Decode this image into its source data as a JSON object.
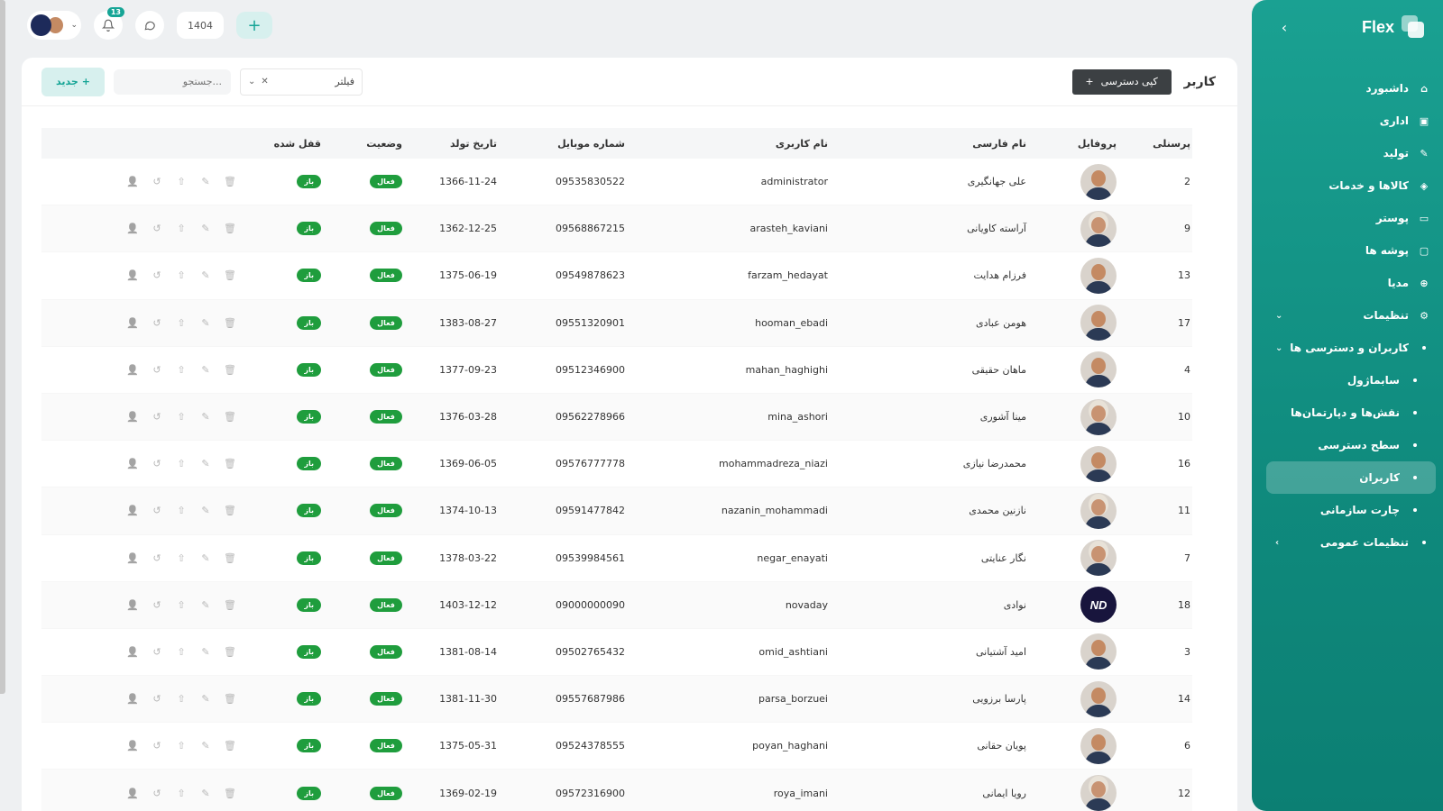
{
  "topbar": {
    "notification_count": "13",
    "year": "1404"
  },
  "sidebar": {
    "brand": "Flex",
    "items": [
      {
        "label": "داشبورد",
        "icon": "home-icon",
        "type": "main"
      },
      {
        "label": "اداری",
        "icon": "briefcase-icon",
        "type": "main"
      },
      {
        "label": "تولید",
        "icon": "production-icon",
        "type": "main"
      },
      {
        "label": "کالاها و خدمات",
        "icon": "box-icon",
        "type": "main"
      },
      {
        "label": "پوستر",
        "icon": "poster-icon",
        "type": "main"
      },
      {
        "label": "پوشه ها",
        "icon": "folder-icon",
        "type": "main"
      },
      {
        "label": "مدیا",
        "icon": "media-icon",
        "type": "main"
      },
      {
        "label": "تنظیمات",
        "icon": "gear-icon",
        "type": "main",
        "expanded": true
      },
      {
        "label": "کاربران و دسترسی ها",
        "type": "sub",
        "expanded": true
      },
      {
        "label": "سابماژول",
        "type": "subsub"
      },
      {
        "label": "نقش‌ها و دپارتمان‌ها",
        "type": "subsub"
      },
      {
        "label": "سطح دسترسی",
        "type": "subsub"
      },
      {
        "label": "کاربران",
        "type": "subsub",
        "active": true
      },
      {
        "label": "چارت سازمانی",
        "type": "subsub"
      },
      {
        "label": "تنظیمات عمومی",
        "type": "sub",
        "expanded": false
      }
    ]
  },
  "toolbar": {
    "title": "کاربر",
    "copy_button": "کپی دسترسی",
    "filter_label": "فیلتر",
    "search_placeholder": "جستجو...",
    "new_button": "جدید"
  },
  "table": {
    "headers": {
      "id": "پرسنلی",
      "profile": "پروفایل",
      "name": "نام فارسی",
      "username": "نام کاربری",
      "mobile": "شماره موبایل",
      "birth": "تاریخ تولد",
      "status": "وضعیت",
      "locked": "قفل شده"
    },
    "rows": [
      {
        "id": "2",
        "name": "علی جهانگیری",
        "username": "administrator",
        "mobile": "09535830522",
        "birth": "1366-11-24",
        "status": "فعال",
        "locked": "باز",
        "avatar": "male"
      },
      {
        "id": "9",
        "name": "آراسته کاویانی",
        "username": "arasteh_kaviani",
        "mobile": "09568867215",
        "birth": "1362-12-25",
        "status": "فعال",
        "locked": "باز",
        "avatar": "female"
      },
      {
        "id": "13",
        "name": "فرزام هدایت",
        "username": "farzam_hedayat",
        "mobile": "09549878623",
        "birth": "1375-06-19",
        "status": "فعال",
        "locked": "باز",
        "avatar": "male"
      },
      {
        "id": "17",
        "name": "هومن عبادی",
        "username": "hooman_ebadi",
        "mobile": "09551320901",
        "birth": "1383-08-27",
        "status": "فعال",
        "locked": "باز",
        "avatar": "male"
      },
      {
        "id": "4",
        "name": "ماهان حقیقی",
        "username": "mahan_haghighi",
        "mobile": "09512346900",
        "birth": "1377-09-23",
        "status": "فعال",
        "locked": "باز",
        "avatar": "male"
      },
      {
        "id": "10",
        "name": "مینا آشوری",
        "username": "mina_ashori",
        "mobile": "09562278966",
        "birth": "1376-03-28",
        "status": "فعال",
        "locked": "باز",
        "avatar": "female"
      },
      {
        "id": "16",
        "name": "محمدرضا نیازی",
        "username": "mohammadreza_niazi",
        "mobile": "09576777778",
        "birth": "1369-06-05",
        "status": "فعال",
        "locked": "باز",
        "avatar": "male"
      },
      {
        "id": "11",
        "name": "نازنین محمدی",
        "username": "nazanin_mohammadi",
        "mobile": "09591477842",
        "birth": "1374-10-13",
        "status": "فعال",
        "locked": "باز",
        "avatar": "female"
      },
      {
        "id": "7",
        "name": "نگار عنایتی",
        "username": "negar_enayati",
        "mobile": "09539984561",
        "birth": "1378-03-22",
        "status": "فعال",
        "locked": "باز",
        "avatar": "female"
      },
      {
        "id": "18",
        "name": "نوادی",
        "username": "novaday",
        "mobile": "09000000090",
        "birth": "1403-12-12",
        "status": "فعال",
        "locked": "باز",
        "avatar": "logo",
        "logo_text": "ND"
      },
      {
        "id": "3",
        "name": "امید آشتیانی",
        "username": "omid_ashtiani",
        "mobile": "09502765432",
        "birth": "1381-08-14",
        "status": "فعال",
        "locked": "باز",
        "avatar": "male"
      },
      {
        "id": "14",
        "name": "پارسا برزویی",
        "username": "parsa_borzuei",
        "mobile": "09557687986",
        "birth": "1381-11-30",
        "status": "فعال",
        "locked": "باز",
        "avatar": "male"
      },
      {
        "id": "6",
        "name": "پویان حقانی",
        "username": "poyan_haghani",
        "mobile": "09524378555",
        "birth": "1375-05-31",
        "status": "فعال",
        "locked": "باز",
        "avatar": "male"
      },
      {
        "id": "12",
        "name": "رویا ایمانی",
        "username": "roya_imani",
        "mobile": "09572316900",
        "birth": "1369-02-19",
        "status": "فعال",
        "locked": "باز",
        "avatar": "female"
      }
    ],
    "row_actions": [
      "user-icon",
      "history-icon",
      "upload-icon",
      "edit-icon",
      "trash-icon"
    ]
  },
  "colors": {
    "accent": "#16a596",
    "sidebar_top": "#1aa192",
    "sidebar_bottom": "#0c7f73",
    "pill_green": "#1f9d3d",
    "copy_button_bg": "#3c4043"
  }
}
